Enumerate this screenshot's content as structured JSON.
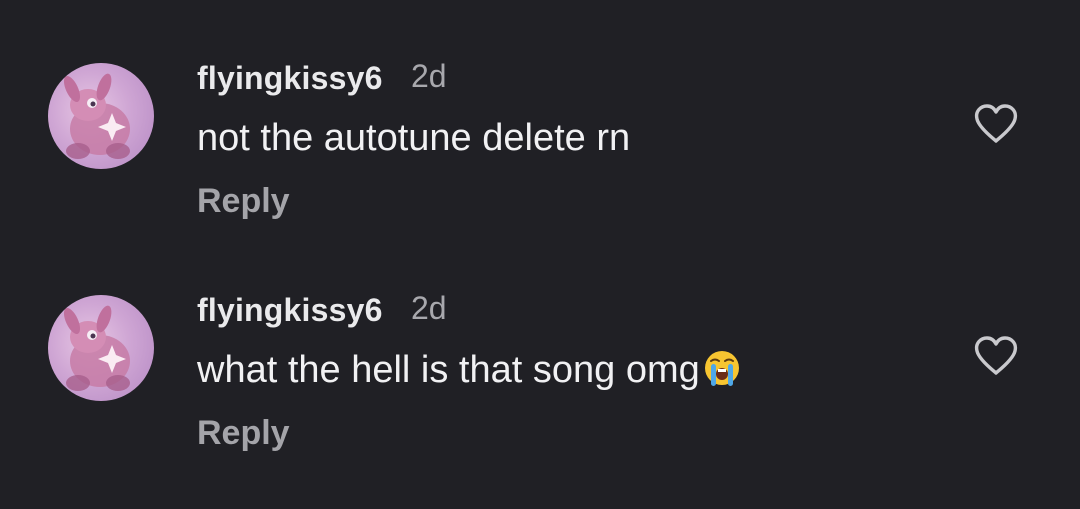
{
  "comments": [
    {
      "username": "flyingkissy6",
      "time": "2d",
      "text": "not the autotune delete rn",
      "reply_label": "Reply",
      "emoji": null
    },
    {
      "username": "flyingkissy6",
      "time": "2d",
      "text": "what the hell is that song omg",
      "reply_label": "Reply",
      "emoji": "loudly-crying-face-emoji"
    }
  ],
  "icons": {
    "like": "heart-outline-icon"
  },
  "colors": {
    "background": "#202025",
    "username": "#eaeaec",
    "secondary": "#a8a8ad",
    "text": "#f1f1f3"
  }
}
